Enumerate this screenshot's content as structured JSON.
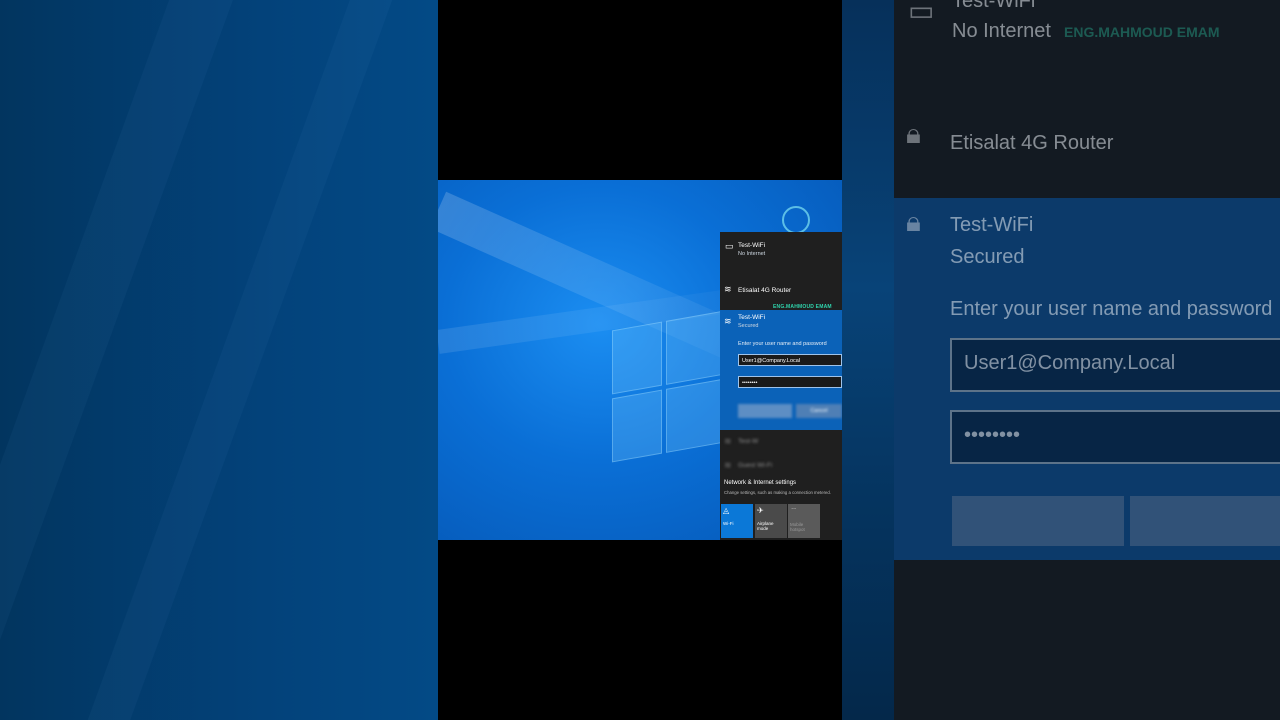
{
  "watermark": "ENG.MAHMOUD EMAM",
  "networks": [
    {
      "name": "Test-WiFi",
      "status": "No Internet",
      "icon": "monitor-icon"
    },
    {
      "name": "Etisalat 4G Router",
      "status": "",
      "icon": "wifi-lock-icon"
    },
    {
      "name": "Test-WiFi",
      "status": "Secured",
      "icon": "wifi-lock-icon"
    }
  ],
  "login": {
    "prompt": "Enter your user name and password",
    "username": "User1@Company.Local",
    "password": "••••••••",
    "ok_label": "",
    "cancel_label": "Cancel"
  },
  "other_networks": [
    "Test-W",
    "Guest Wi-Fi"
  ],
  "settings": {
    "title": "Network & Internet settings",
    "subtitle": "Change settings, such as making a connection metered."
  },
  "quick_actions": [
    {
      "label": "Wi-Fi",
      "icon": "wifi-icon",
      "active": true
    },
    {
      "label": "Airplane mode",
      "icon": "airplane-icon",
      "active": false
    },
    {
      "label": "Mobile hotspot",
      "icon": "hotspot-icon",
      "active": false
    }
  ],
  "colors": {
    "accent": "#0b62b8",
    "flyout_bg": "#1f1f1f",
    "watermark": "#2fd5ad"
  }
}
